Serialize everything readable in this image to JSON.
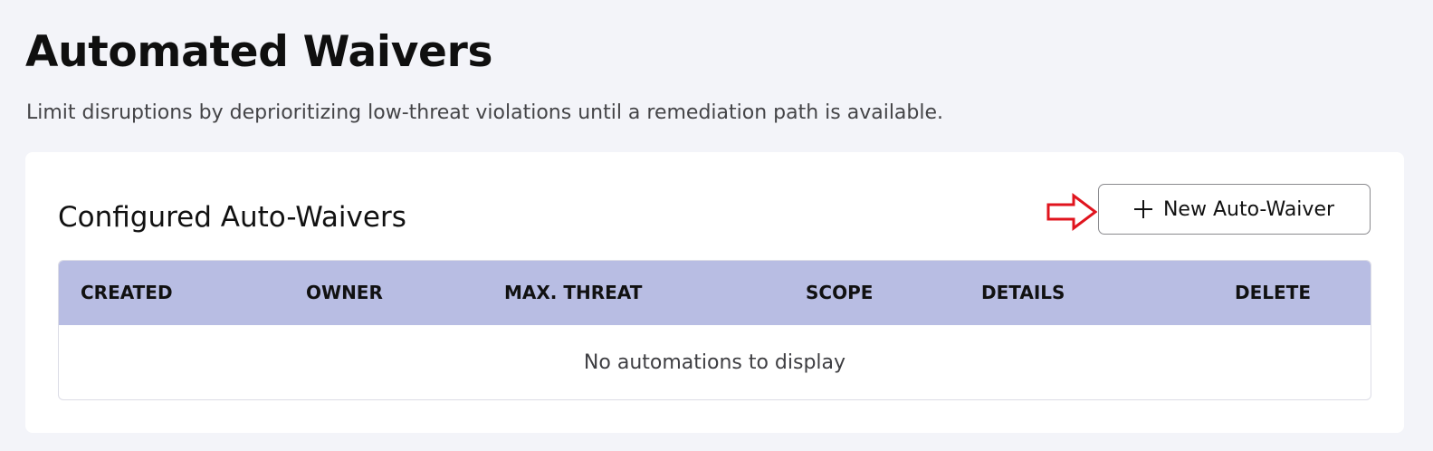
{
  "page": {
    "title": "Automated Waivers",
    "subtitle": "Limit disruptions by deprioritizing low-threat violations until a remediation path is available."
  },
  "section": {
    "title": "Configured Auto-Waivers",
    "new_button_label": "New Auto-Waiver",
    "new_button_icon": "plus-icon",
    "callout_icon": "arrow-right-icon",
    "callout_color": "#e0141e"
  },
  "table": {
    "header_color": "#b8bde3",
    "columns": [
      "CREATED",
      "OWNER",
      "MAX. THREAT",
      "SCOPE",
      "DETAILS",
      "DELETE"
    ],
    "empty_message": "No automations to display"
  }
}
